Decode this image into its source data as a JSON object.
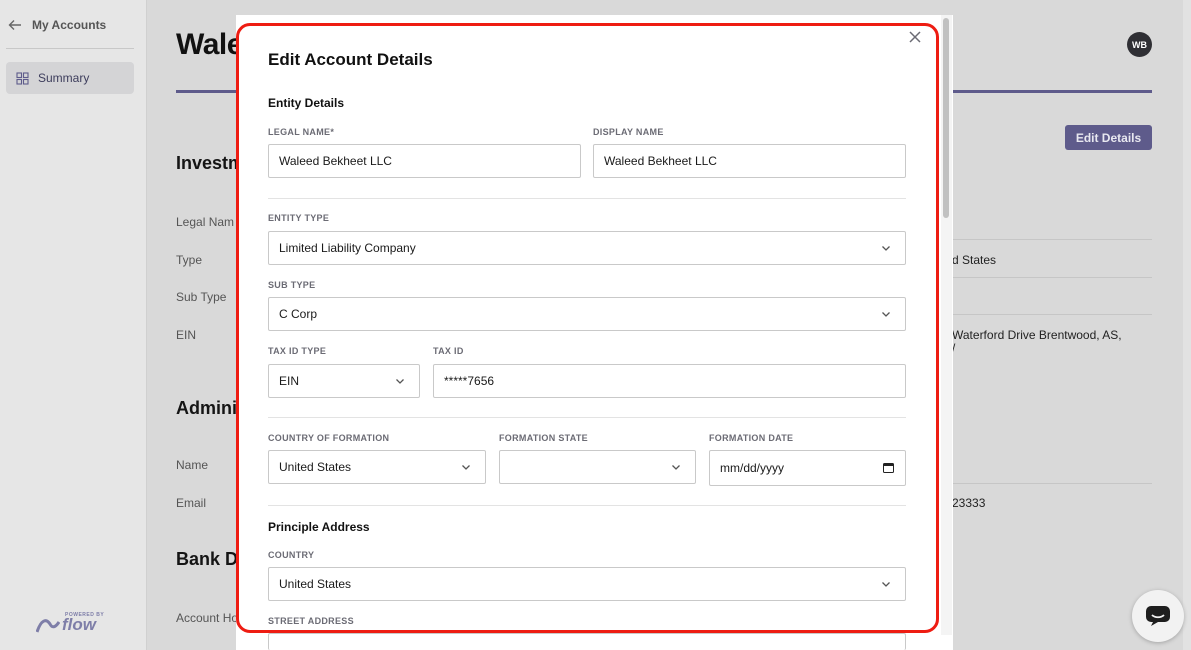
{
  "sidebar": {
    "back_label": "My Accounts",
    "items": [
      {
        "label": "Summary"
      }
    ],
    "brand": {
      "powered_by": "POWERED BY",
      "name": "flow"
    }
  },
  "page": {
    "title": "Wale",
    "avatar_initials": "WB",
    "edit_button": "Edit Details",
    "sections": [
      "Investm",
      "Admini",
      "Bank De"
    ],
    "rows": [
      {
        "label": "Legal Nam",
        "value": ""
      },
      {
        "label": "Type",
        "value": "d States"
      },
      {
        "label": "Sub Type",
        "value": ""
      },
      {
        "label": "EIN",
        "value": "Waterford Drive Brentwood, AS,",
        "value2": "/"
      },
      {
        "label": "Name",
        "value": ""
      },
      {
        "label": "Email",
        "value": "23333"
      },
      {
        "label": "Account Ho",
        "value": ""
      }
    ]
  },
  "modal": {
    "title": "Edit Account Details",
    "entity_section": "Entity Details",
    "legal_name": {
      "label": "LEGAL NAME*",
      "value": "Waleed Bekheet LLC"
    },
    "display_name": {
      "label": "DISPLAY NAME",
      "value": "Waleed Bekheet LLC"
    },
    "entity_type": {
      "label": "ENTITY TYPE",
      "value": "Limited Liability Company"
    },
    "sub_type": {
      "label": "SUB TYPE",
      "value": "C Corp"
    },
    "tax_id_type": {
      "label": "TAX ID TYPE",
      "value": "EIN"
    },
    "tax_id": {
      "label": "TAX ID",
      "value": "*****7656"
    },
    "country_formation": {
      "label": "COUNTRY OF FORMATION",
      "value": "United States"
    },
    "formation_state": {
      "label": "FORMATION STATE",
      "value": ""
    },
    "formation_date": {
      "label": "FORMATION DATE",
      "value": "mm/dd/yyyy"
    },
    "address_section": "Principle Address",
    "country": {
      "label": "COUNTRY",
      "value": "United States"
    },
    "street_address": {
      "label": "STREET ADDRESS",
      "value": ""
    }
  },
  "colors": {
    "accent": "#5e5b8b",
    "highlight": "#ee1c12"
  }
}
